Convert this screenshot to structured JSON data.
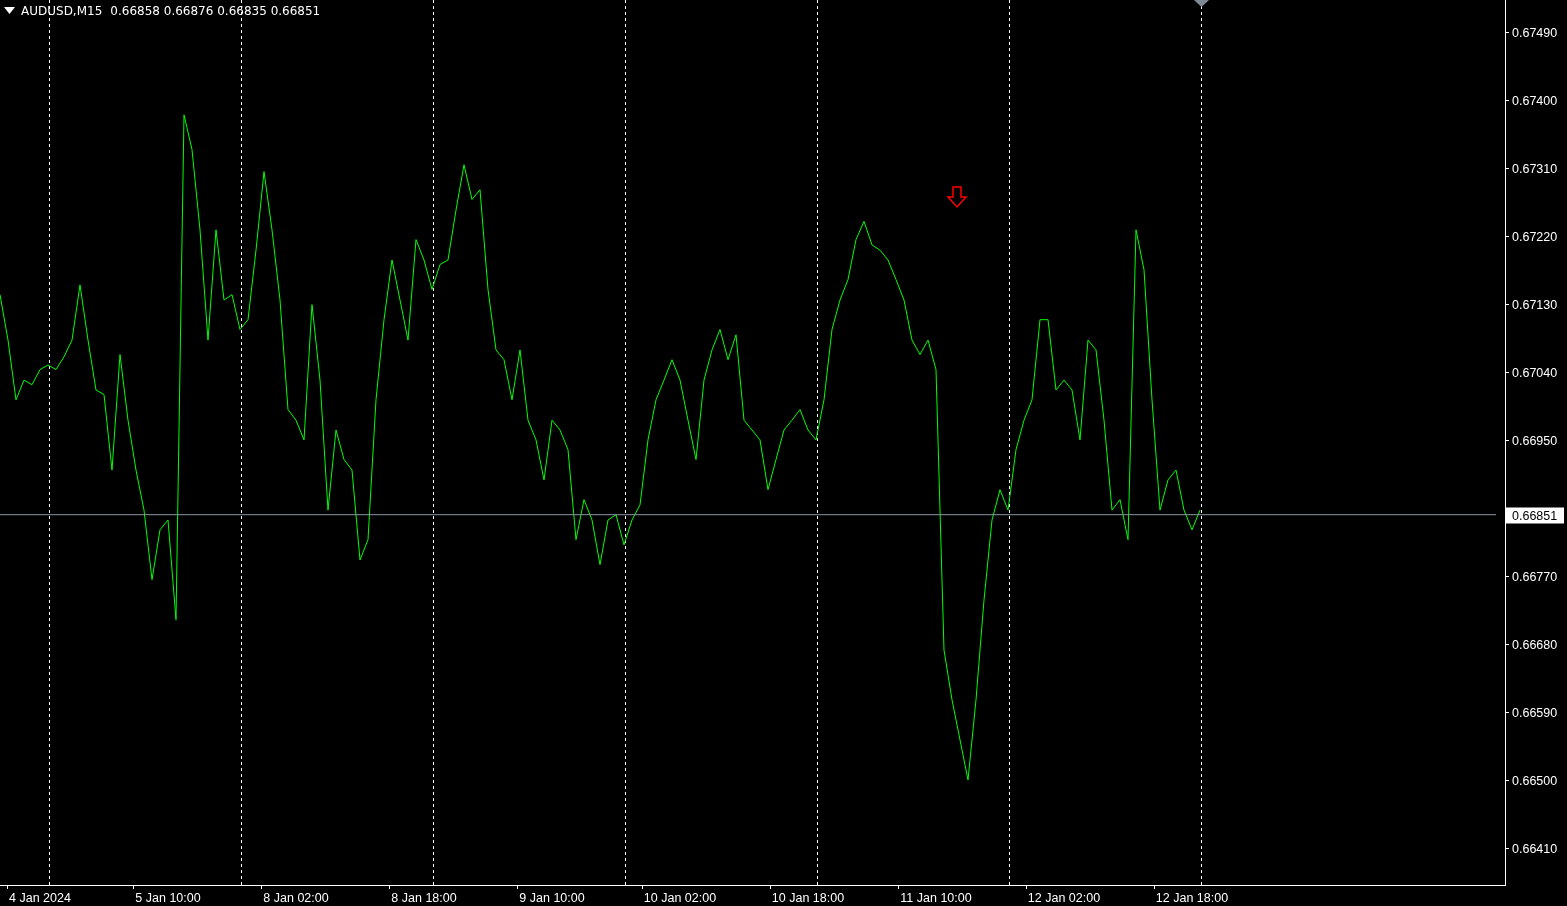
{
  "header": {
    "symbol": "AUDUSD,M15",
    "quotes": "0.66858 0.66876 0.66835 0.66851"
  },
  "chart": {
    "chart_data": {
      "type": "line",
      "categories": [
        null,
        null,
        null,
        null,
        null,
        "4 Jan 2024",
        null,
        null,
        null,
        null,
        null,
        null,
        null,
        null,
        null,
        null,
        null,
        null,
        null,
        null,
        null,
        "5 Jan 10:00",
        null,
        null,
        null,
        null,
        null,
        null,
        null,
        null,
        null,
        null,
        null,
        null,
        null,
        null,
        null,
        "8 Jan 02:00",
        null,
        null,
        null,
        null,
        null,
        null,
        null,
        null,
        null,
        null,
        null,
        null,
        null,
        null,
        null,
        "8 Jan 18:00",
        null,
        null,
        null,
        null,
        null,
        null,
        null,
        null,
        null,
        null,
        null,
        null,
        null,
        null,
        null,
        "9 Jan 10:00",
        null,
        null,
        null,
        null,
        null,
        null,
        null,
        null,
        null,
        null,
        null,
        null,
        null,
        null,
        null,
        "10 Jan 02:00",
        null,
        null,
        null,
        null,
        null,
        null,
        null,
        null,
        null,
        null,
        null,
        null,
        null,
        null,
        null,
        "10 Jan 18:00",
        null,
        null,
        null,
        null,
        null,
        null,
        null,
        null,
        null,
        null,
        null,
        null,
        null,
        null,
        null,
        "11 Jan 10:00",
        null,
        null,
        null,
        null,
        null,
        null,
        null,
        null,
        null,
        null,
        null,
        null,
        null,
        null,
        null,
        "12 Jan 02:00",
        null,
        null,
        null,
        null,
        null,
        null,
        null,
        null,
        null,
        null,
        null,
        null,
        null,
        null,
        null,
        "12 Jan 18:00",
        null,
        null,
        null,
        null,
        null,
        null,
        null,
        null,
        null,
        null,
        null,
        null,
        null,
        null,
        null,
        null,
        null,
        null,
        null,
        null,
        null,
        null,
        null,
        null,
        null,
        null,
        null,
        null,
        null,
        null,
        null,
        null,
        null,
        null,
        null,
        null,
        null,
        null
      ],
      "series": [
        {
          "color": "#00ff00",
          "values": [
            0.67142,
            0.67082,
            0.67003,
            0.67029,
            0.67023,
            0.67043,
            0.67049,
            0.67043,
            0.6706,
            0.67082,
            0.67155,
            0.67082,
            0.67016,
            0.6701,
            0.6691,
            0.67063,
            0.66976,
            0.6691,
            0.66857,
            0.66765,
            0.66831,
            0.66844,
            0.66712,
            0.6738,
            0.67334,
            0.67228,
            0.67082,
            0.67228,
            0.67135,
            0.67142,
            0.67096,
            0.67109,
            0.67201,
            0.67305,
            0.67228,
            0.67135,
            0.6699,
            0.66976,
            0.6695,
            0.67129,
            0.67029,
            0.66857,
            0.66963,
            0.66924,
            0.6691,
            0.66791,
            0.66818,
            0.67003,
            0.67109,
            0.67188,
            0.67135,
            0.67082,
            0.67215,
            0.67188,
            0.67149,
            0.67182,
            0.67188,
            0.67254,
            0.67314,
            0.67268,
            0.67281,
            0.67149,
            0.67069,
            0.67056,
            0.67003,
            0.67069,
            0.66976,
            0.6695,
            0.66897,
            0.66976,
            0.66963,
            0.66937,
            0.66818,
            0.66871,
            0.66844,
            0.66785,
            0.66844,
            0.66851,
            0.66811,
            0.66844,
            0.66864,
            0.6695,
            0.67003,
            0.67029,
            0.67056,
            0.67029,
            0.66976,
            0.66924,
            0.67029,
            0.67069,
            0.67096,
            0.67056,
            0.67089,
            0.66976,
            0.66963,
            0.6695,
            0.66884,
            0.66924,
            0.66963,
            0.66976,
            0.6699,
            0.66963,
            0.6695,
            0.67003,
            0.67096,
            0.67135,
            0.67162,
            0.67215,
            0.67239,
            0.67208,
            0.67201,
            0.67188,
            0.67162,
            0.67135,
            0.67082,
            0.67063,
            0.67082,
            0.67043,
            0.66672,
            0.66606,
            0.66553,
            0.665,
            0.66606,
            0.66738,
            0.66844,
            0.66884,
            0.66857,
            0.66937,
            0.66976,
            0.67003,
            0.67109,
            0.67109,
            0.67016,
            0.67029,
            0.67016,
            0.6695,
            0.67082,
            0.67069,
            0.66976,
            0.66857,
            0.66871,
            0.66818,
            0.67228,
            0.67175,
            0.67003,
            0.66857,
            0.66897,
            0.6691,
            0.66857,
            0.66831,
            0.66857,
            null,
            null,
            null,
            null,
            null,
            null,
            null,
            null,
            null,
            null,
            null,
            null,
            null,
            null,
            null,
            null,
            null,
            null,
            null,
            null,
            null,
            null,
            null,
            null,
            null,
            null,
            null,
            null,
            null,
            null,
            null,
            null,
            null,
            null,
            null,
            null,
            null
          ]
        },
        {
          "color": "#8a96a3",
          "values": [
            0.66851,
            0.66851,
            0.66851,
            0.66851,
            0.66851,
            0.66851,
            0.66851,
            0.66851,
            0.66851,
            0.66851,
            0.66851,
            0.66851,
            0.66851,
            0.66851,
            0.66851,
            0.66851,
            0.66851,
            0.66851,
            0.66851,
            0.66851,
            0.66851,
            0.66851,
            0.66851,
            0.66851,
            0.66851,
            0.66851,
            0.66851,
            0.66851,
            0.66851,
            0.66851,
            0.66851,
            0.66851,
            0.66851,
            0.66851,
            0.66851,
            0.66851,
            0.66851,
            0.66851,
            0.66851,
            0.66851,
            0.66851,
            0.66851,
            0.66851,
            0.66851,
            0.66851,
            0.66851,
            0.66851,
            0.66851,
            0.66851,
            0.66851,
            0.66851,
            0.66851,
            0.66851,
            0.66851,
            0.66851,
            0.66851,
            0.66851,
            0.66851,
            0.66851,
            0.66851,
            0.66851,
            0.66851,
            0.66851,
            0.66851,
            0.66851,
            0.66851,
            0.66851,
            0.66851,
            0.66851,
            0.66851,
            0.66851,
            0.66851,
            0.66851,
            0.66851,
            0.66851,
            0.66851,
            0.66851,
            0.66851,
            0.66851,
            0.66851,
            0.66851,
            0.66851,
            0.66851,
            0.66851,
            0.66851,
            0.66851,
            0.66851,
            0.66851,
            0.66851,
            0.66851,
            0.66851,
            0.66851,
            0.66851,
            0.66851,
            0.66851,
            0.66851,
            0.66851,
            0.66851,
            0.66851,
            0.66851,
            0.66851,
            0.66851,
            0.66851,
            0.66851,
            0.66851,
            0.66851,
            0.66851,
            0.66851,
            0.66851,
            0.66851,
            0.66851,
            0.66851,
            0.66851,
            0.66851,
            0.66851,
            0.66851,
            0.66851,
            0.66851,
            0.66851,
            0.66851,
            0.66851,
            0.66851,
            0.66851,
            0.66851,
            0.66851,
            0.66851,
            0.66851,
            0.66851,
            0.66851,
            0.66851,
            0.66851,
            0.66851,
            0.66851,
            0.66851,
            0.66851,
            0.66851,
            0.66851,
            0.66851,
            0.66851,
            0.66851,
            0.66851,
            0.66851,
            0.66851,
            0.66851,
            0.66851,
            0.66851,
            0.66851,
            0.66851,
            0.66851,
            0.66851,
            0.66851,
            0.66851,
            0.66851,
            0.66851,
            0.66851,
            0.66851,
            0.66851,
            0.66851,
            0.66851,
            0.66851,
            0.66851,
            0.66851,
            0.66851,
            0.66851,
            0.66851,
            0.66851,
            0.66851,
            0.66851,
            0.66851,
            0.66851,
            0.66851,
            0.66851,
            0.66851,
            0.66851,
            0.66851,
            0.66851,
            0.66851,
            0.66851,
            0.66851,
            0.66851,
            0.66851,
            0.66851,
            0.66851,
            0.66851,
            0.66851,
            0.66851,
            0.66851,
            0.66851
          ]
        }
      ],
      "ylim": [
        0.66361,
        0.67532
      ],
      "yticks": [
        {
          "value": 0.6749,
          "label": "0.67490"
        },
        {
          "value": 0.674,
          "label": "0.67400"
        },
        {
          "value": 0.6731,
          "label": "0.67310"
        },
        {
          "value": 0.6722,
          "label": "0.67220"
        },
        {
          "value": 0.6713,
          "label": "0.67130"
        },
        {
          "value": 0.6704,
          "label": "0.67040"
        },
        {
          "value": 0.6695,
          "label": "0.66950"
        },
        {
          "value": 0.6677,
          "label": "0.66770"
        },
        {
          "value": 0.6668,
          "label": "0.66680"
        },
        {
          "value": 0.6659,
          "label": "0.66590"
        },
        {
          "value": 0.665,
          "label": "0.66500"
        },
        {
          "value": 0.6641,
          "label": "0.66410"
        }
      ],
      "xlabel": null
    },
    "price_label": "0.66851"
  }
}
